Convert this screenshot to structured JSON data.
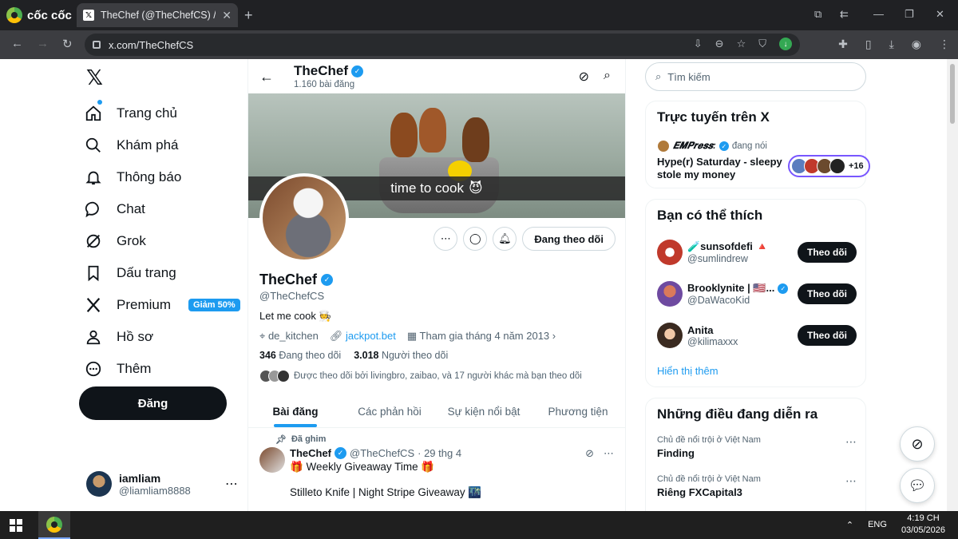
{
  "browser": {
    "brand": "cốc cốc",
    "tab_title": "TheChef (@TheChefCS) / X",
    "url": "x.com/TheChefCS"
  },
  "nav": {
    "items": [
      {
        "label": "Trang chủ",
        "icon": "home-icon"
      },
      {
        "label": "Khám phá",
        "icon": "search-icon"
      },
      {
        "label": "Thông báo",
        "icon": "bell-icon"
      },
      {
        "label": "Chat",
        "icon": "chat-icon"
      },
      {
        "label": "Grok",
        "icon": "grok-icon"
      },
      {
        "label": "Dấu trang",
        "icon": "bookmark-icon"
      },
      {
        "label": "Premium",
        "icon": "x-icon",
        "badge": "Giảm 50%"
      },
      {
        "label": "Hồ sơ",
        "icon": "person-icon"
      },
      {
        "label": "Thêm",
        "icon": "more-circle-icon"
      }
    ],
    "post_button": "Đăng",
    "me": {
      "name": "iamliam",
      "handle": "@liamliam8888"
    }
  },
  "profile": {
    "header_name": "TheChef",
    "post_count": "1.160 bài đăng",
    "banner_caption": "time to cook",
    "banner_emoji": "😈",
    "following_button": "Đang theo dõi",
    "name": "TheChef",
    "handle": "@TheChefCS",
    "bio": "Let me cook 🧑‍🍳",
    "location": "de_kitchen",
    "website": "jackpot.bet",
    "joined": "Tham gia tháng 4 năm 2013",
    "following_count": "346",
    "following_label": "Đang theo dõi",
    "followers_count": "3.018",
    "followers_label": "Người theo dõi",
    "followed_by": "Được theo dõi bởi livingbro, zaibao, và 17 người khác mà bạn theo dõi",
    "tabs": [
      "Bài đăng",
      "Các phản hồi",
      "Sự kiện nổi bật",
      "Phương tiện"
    ]
  },
  "pinned_post": {
    "pinned_label": "Đã ghim",
    "author": "TheChef",
    "handle": "@TheChefCS",
    "date": "· 29 thg 4",
    "line1": "🎁 Weekly Giveaway Time 🎁",
    "line2": "Stilleto Knife | Night Stripe Giveaway 🌃"
  },
  "right": {
    "search_placeholder": "Tìm kiếm",
    "live": {
      "title": "Trực tuyến trên X",
      "host": "𝑬𝑴𝑷𝒓𝒆𝒔𝒔:",
      "status": "đang nói",
      "space_title": "Hype(r) Saturday - sleepy stole my money",
      "listeners": "+16"
    },
    "who_to_follow": {
      "title": "Bạn có thể thích",
      "follow_label": "Theo dõi",
      "show_more": "Hiển thị thêm",
      "users": [
        {
          "name": "🧪sunsofdefi 🔺",
          "handle": "@sumlindrew",
          "verified": false
        },
        {
          "name": "Brooklynite | 🇺🇸...",
          "handle": "@DaWacoKid",
          "verified": true
        },
        {
          "name": "Anita",
          "handle": "@kilimaxxx",
          "verified": false
        }
      ]
    },
    "trends": {
      "title": "Những điều đang diễn ra",
      "items": [
        {
          "context": "Chủ đề nổi trội ở Việt Nam",
          "name": "Finding"
        },
        {
          "context": "Chủ đề nổi trội ở Việt Nam",
          "name": "Riêng FXCapital3"
        }
      ]
    }
  },
  "taskbar": {
    "lang": "ENG",
    "time": "4:19 CH",
    "date": "03/05/2026"
  },
  "colors": {
    "accent": "#1d9bf0",
    "dark": "#0f1419",
    "muted": "#536471"
  }
}
